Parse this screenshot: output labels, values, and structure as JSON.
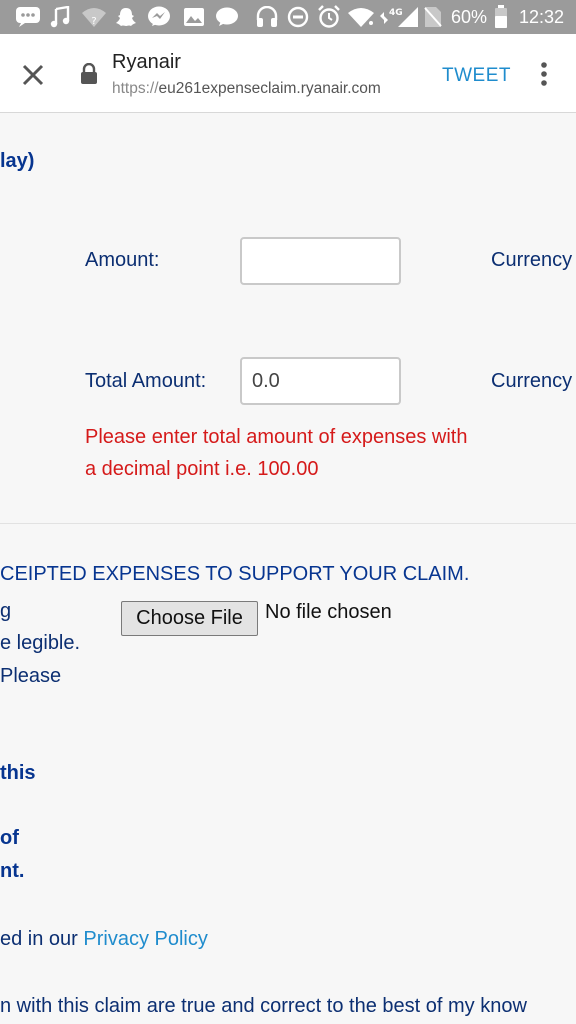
{
  "status_bar": {
    "battery_percent": "60%",
    "time": "12:32",
    "network_label": "4G",
    "icons": [
      "messages-icon",
      "music-icon",
      "wifi-unknown-icon",
      "snapchat-icon",
      "messenger-icon",
      "gallery-icon",
      "chat-icon",
      "headphones-icon",
      "dnd-icon",
      "alarm-icon",
      "wifi-icon",
      "signal-icon",
      "no-sim-icon",
      "battery-icon"
    ]
  },
  "browser": {
    "title": "Ryanair",
    "url_scheme": "https://",
    "url_host": "eu261expenseclaim.ryanair.com",
    "tweet_label": "TWEET"
  },
  "form": {
    "heading_fragment": "lay)",
    "amount_label": "Amount:",
    "amount_value": "",
    "currency_label": "Currency",
    "total_label": "Total Amount:",
    "total_value": "0.0",
    "total_currency_label": "Currency",
    "error_message": "Please enter total amount of expenses with a decimal point i.e. 100.00"
  },
  "upload": {
    "heading": "CEIPTED EXPENSES TO SUPPORT YOUR CLAIM.",
    "frag_1": "g",
    "frag_2": "e legible.",
    "frag_3": " Please",
    "choose_file_label": "Choose File",
    "file_status": "No file chosen"
  },
  "footer": {
    "bold_1": "this",
    "bold_2": "of",
    "bold_3": "nt.",
    "privacy_prefix": "ed in our ",
    "privacy_link": "Privacy Policy",
    "confirm_text": "n with this claim are true and correct to the best of my know"
  }
}
